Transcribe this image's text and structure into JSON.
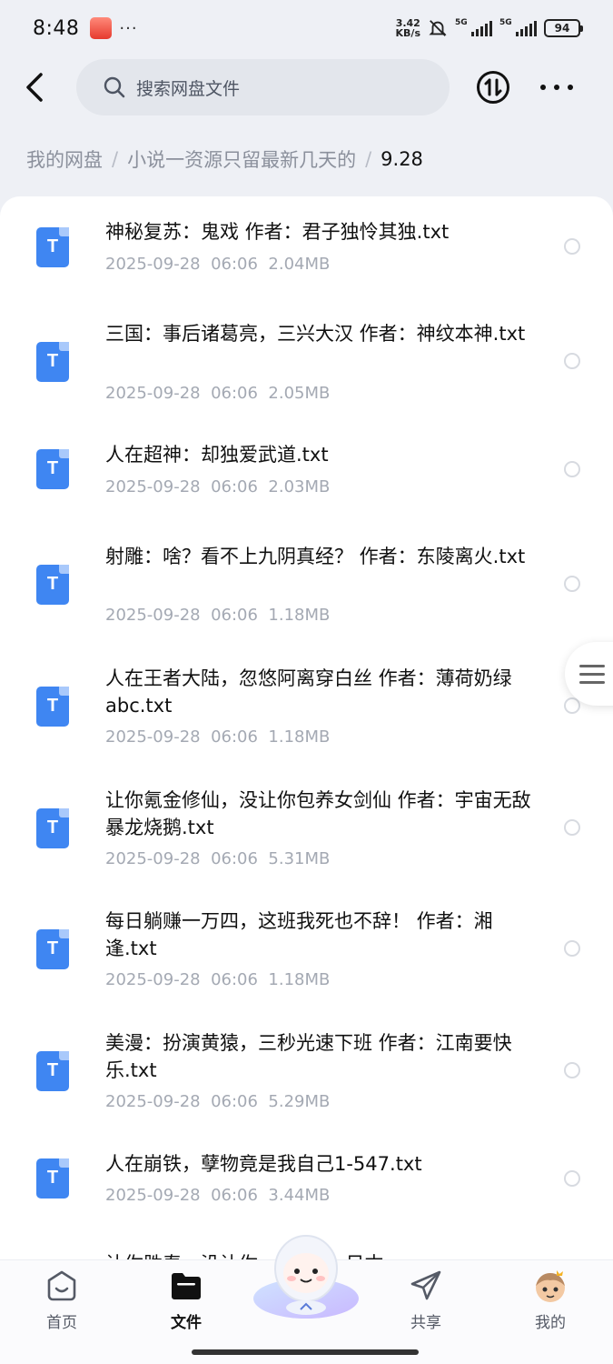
{
  "status_bar": {
    "time": "8:48",
    "more": "···",
    "net_speed_value": "3.42",
    "net_speed_unit": "KB/s",
    "signal1_label": "5G",
    "signal2_label": "5G",
    "battery": "94"
  },
  "header": {
    "search_placeholder": "搜索网盘文件"
  },
  "breadcrumb": {
    "items": [
      "我的网盘",
      "小说一资源只留最新几天的"
    ],
    "current": "9.28"
  },
  "files": [
    {
      "name": "神秘复苏：鬼戏 作者：君子独怜其独.txt",
      "date": "2025-09-28",
      "time": "06:06",
      "size": "2.04MB"
    },
    {
      "name": "三国：事后诸葛亮，三兴大汉 作者：神纹本神.txt",
      "date": "2025-09-28",
      "time": "06:06",
      "size": "2.05MB"
    },
    {
      "name": "人在超神：却独爱武道.txt",
      "date": "2025-09-28",
      "time": "06:06",
      "size": "2.03MB"
    },
    {
      "name": "射雕：啥？看不上九阴真经？ 作者：东陵离火.txt",
      "date": "2025-09-28",
      "time": "06:06",
      "size": "1.18MB"
    },
    {
      "name": "人在王者大陆，忽悠阿离穿白丝 作者：薄荷奶绿abc.txt",
      "date": "2025-09-28",
      "time": "06:06",
      "size": "1.18MB"
    },
    {
      "name": "让你氪金修仙，没让你包养女剑仙 作者：宇宙无敌暴龙烧鹅.txt",
      "date": "2025-09-28",
      "time": "06:06",
      "size": "5.31MB"
    },
    {
      "name": "每日躺赚一万四，这班我死也不辞！ 作者：湘逢.txt",
      "date": "2025-09-28",
      "time": "06:06",
      "size": "1.18MB"
    },
    {
      "name": "美漫：扮演黄猿，三秒光速下班 作者：江南要快乐.txt",
      "date": "2025-09-28",
      "time": "06:06",
      "size": "5.29MB"
    },
    {
      "name": "人在崩铁，孽物竟是我自己1-547.txt",
      "date": "2025-09-28",
      "time": "06:06",
      "size": "3.44MB"
    }
  ],
  "file_icon_letter": "T",
  "peek_text": "让你胜寿，没让你 ... 作者：日本",
  "bottom_nav": {
    "home": "首页",
    "files": "文件",
    "share": "共享",
    "mine": "我的"
  },
  "colors": {
    "accent": "#3f86f2",
    "background": "#eef0f5",
    "meta_text": "#a4a9b3"
  }
}
